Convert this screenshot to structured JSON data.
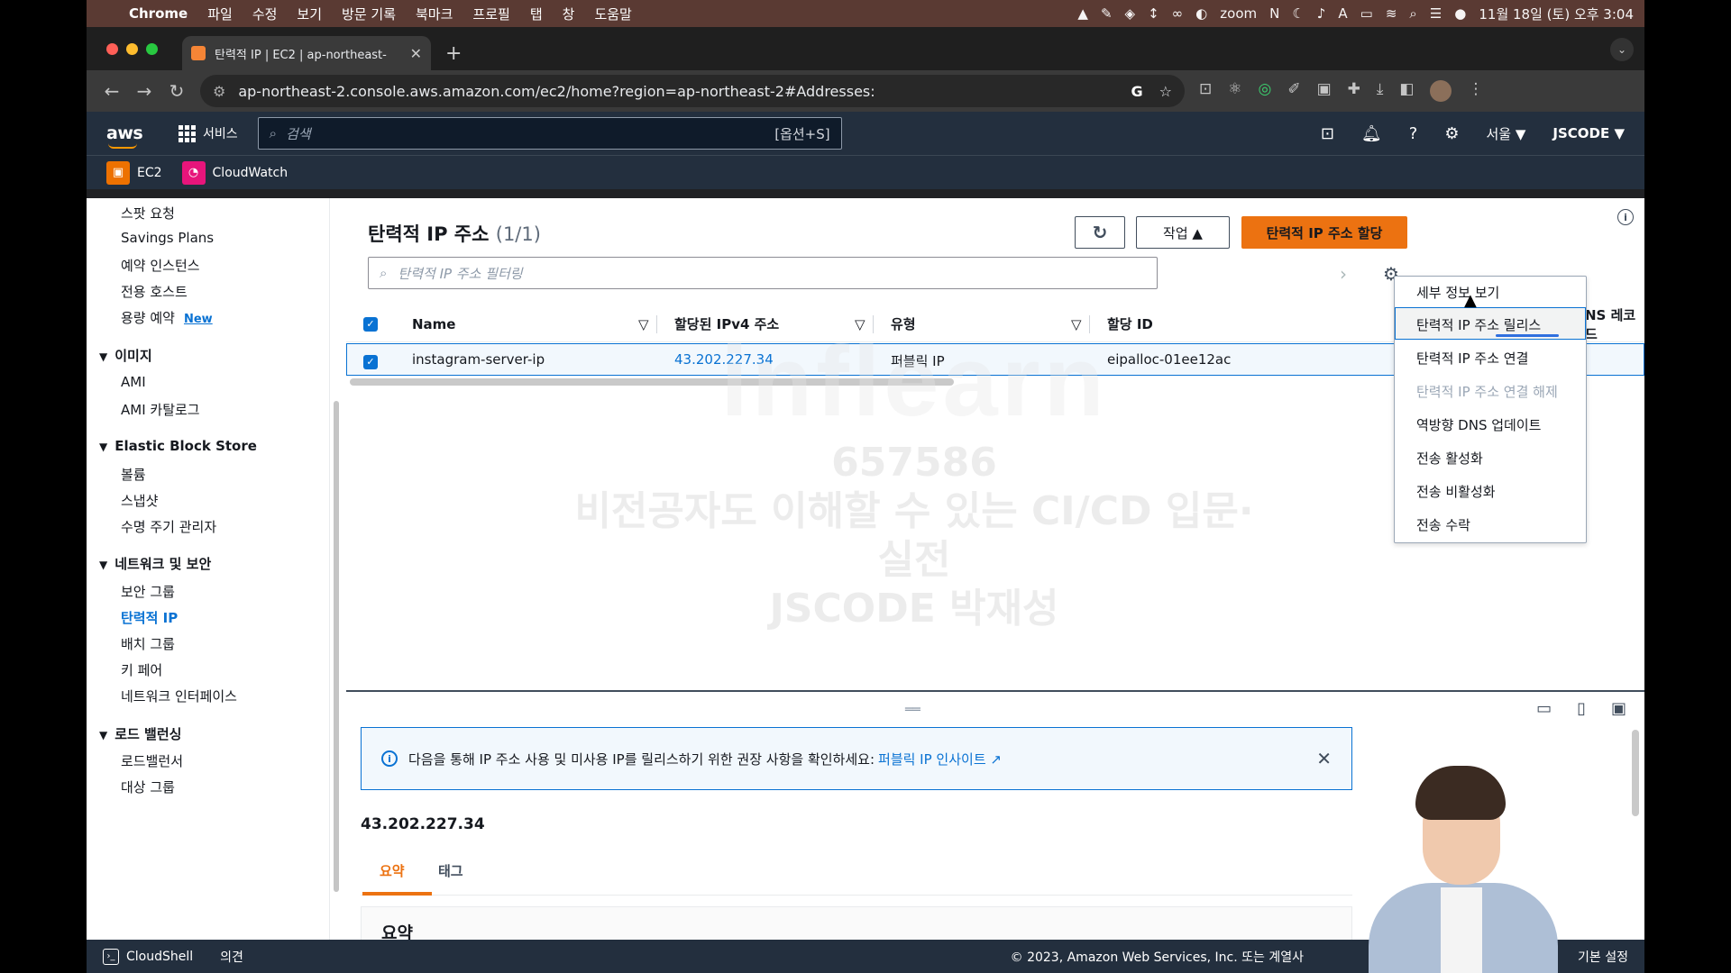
{
  "mac_menubar": {
    "app": "Chrome",
    "menus": [
      "파일",
      "수정",
      "보기",
      "방문 기록",
      "북마크",
      "프로필",
      "탭",
      "창",
      "도움말"
    ],
    "zoom": "zoom",
    "clock": "11월 18일 (토) 오후 3:04"
  },
  "browser": {
    "tab_title": "탄력적 IP | EC2 | ap-northeast-",
    "url": "ap-northeast-2.console.aws.amazon.com/ec2/home?region=ap-northeast-2#Addresses:"
  },
  "aws_header": {
    "logo": "aws",
    "services_label": "서비스",
    "search_placeholder": "검색",
    "search_shortcut": "[옵션+S]",
    "region": "서울 ▼",
    "account": "JSCODE ▼"
  },
  "favorites": [
    {
      "label": "EC2",
      "color": "#ed7100"
    },
    {
      "label": "CloudWatch",
      "color": "#e7157b"
    }
  ],
  "sidebar": {
    "items_top": [
      "스팟 요청",
      "Savings Plans",
      "예약 인스턴스",
      "전용 호스트",
      "용량 예약"
    ],
    "new_badge": "New",
    "sections": [
      {
        "title": "이미지",
        "items": [
          "AMI",
          "AMI 카탈로그"
        ]
      },
      {
        "title": "Elastic Block Store",
        "items": [
          "볼륨",
          "스냅샷",
          "수명 주기 관리자"
        ]
      },
      {
        "title": "네트워크 및 보안",
        "items": [
          "보안 그룹",
          "탄력적 IP",
          "배치 그룹",
          "키 페어",
          "네트워크 인터페이스"
        ]
      },
      {
        "title": "로드 밸런싱",
        "items": [
          "로드밸런서",
          "대상 그룹"
        ]
      }
    ],
    "active_item": "탄력적 IP"
  },
  "main": {
    "title": "탄력적 IP 주소",
    "count": "(1/1)",
    "actions_label": "작업 ▲",
    "allocate_label": "탄력적 IP 주소 할당",
    "filter_placeholder": "탄력적 IP 주소 필터링",
    "columns": [
      "Name",
      "할당된 IPv4 주소",
      "유형",
      "할당 ID",
      "NS 레코드"
    ],
    "rows": [
      {
        "name": "instagram-server-ip",
        "ipv4": "43.202.227.34",
        "type": "퍼블릭 IP",
        "allocation_id": "eipalloc-01ee12ac"
      }
    ],
    "actions_menu": [
      {
        "label": "세부 정보 보기",
        "disabled": false
      },
      {
        "label": "탄력적 IP 주소 릴리스",
        "disabled": false
      },
      {
        "label": "탄력적 IP 주소 연결",
        "disabled": false
      },
      {
        "label": "탄력적 IP 주소 연결 해제",
        "disabled": true
      },
      {
        "label": "역방향 DNS 업데이트",
        "disabled": false
      },
      {
        "label": "전송 활성화",
        "disabled": false
      },
      {
        "label": "전송 비활성화",
        "disabled": false
      },
      {
        "label": "전송 수락",
        "disabled": false
      }
    ]
  },
  "watermark": {
    "logo": "inflearn",
    "code": "657586",
    "line1": "비전공자도 이해할 수 있는 CI/CD 입문·실전",
    "line2": "JSCODE 박재성"
  },
  "details": {
    "info_text": "다음을 통해 IP 주소 사용 및 미사용 IP를 릴리스하기 위한 권장 사항을 확인하세요:",
    "info_link": "퍼블릭 IP 인사이트",
    "selected_ip": "43.202.227.34",
    "tabs": [
      "요약",
      "태그"
    ],
    "summary_title": "요약"
  },
  "footer": {
    "cloudshell": "CloudShell",
    "feedback": "의견",
    "copyright": "© 2023, Amazon Web Services, Inc. 또는 계열사",
    "settings": "기본 설정"
  }
}
